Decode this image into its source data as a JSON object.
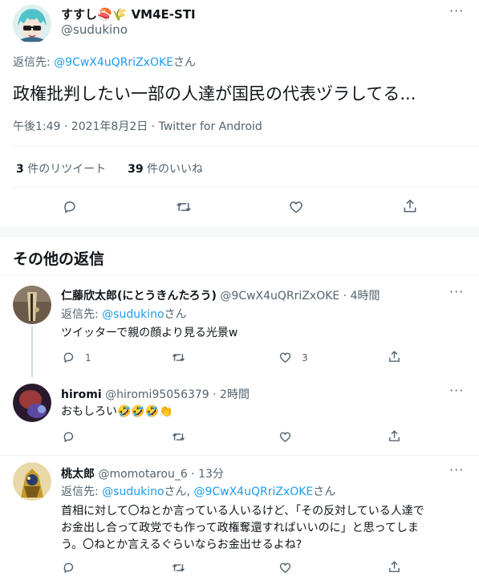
{
  "main_tweet": {
    "display_name": "すすし🍣🌾 VM4E-STI",
    "handle": "@sudukino",
    "reply_prefix": "返信先: ",
    "reply_to": "@9CwX4uQRriZxOKE",
    "reply_suffix": "さん",
    "text": "政権批判したい一部の人達が国民の代表ヅラしてる...",
    "timestamp": "午後1:49 · 2021年8月2日 · Twitter for Android",
    "retweet_count": "3",
    "retweet_label": " 件のリツイート",
    "like_count": "39",
    "like_label": " 件のいいね"
  },
  "section_title": "その他の返信",
  "replies": [
    {
      "display_name": "仁藤欣太郎(にとうきんたろう)",
      "handle": "@9CwX4uQRriZxOKE",
      "time": " · 4時間",
      "reply_prefix": "返信先: ",
      "reply_to": "@sudukino",
      "reply_suffix": "さん",
      "text": "ツイッターで親の顔より見る光景w",
      "reply_count": "1",
      "like_count": "3"
    },
    {
      "display_name": "hiromi",
      "handle": "@hiromi95056379",
      "time": " · 2時間",
      "text": "おもしろい🤣🤣🤣👏"
    },
    {
      "display_name": "桃太郎",
      "handle": "@momotarou_6",
      "time": " · 13分",
      "reply_prefix": "返信先: ",
      "reply_to": "@sudukino",
      "reply_mid": "さん, ",
      "reply_to2": "@9CwX4uQRriZxOKE",
      "reply_suffix": "さん",
      "text_lines": [
        "首相に対して〇ねとか言っている人いるけど、「その反対している人達で",
        "お金出し合って政党でも作って政権奪還すればいいのに」と思ってしま",
        "う。〇ねとか言えるぐらいならお金出せるよね?"
      ]
    }
  ],
  "more_glyph": "···",
  "colors": {
    "accent": "#1d9bf0",
    "muted": "#536471",
    "divider": "#eff3f4"
  }
}
